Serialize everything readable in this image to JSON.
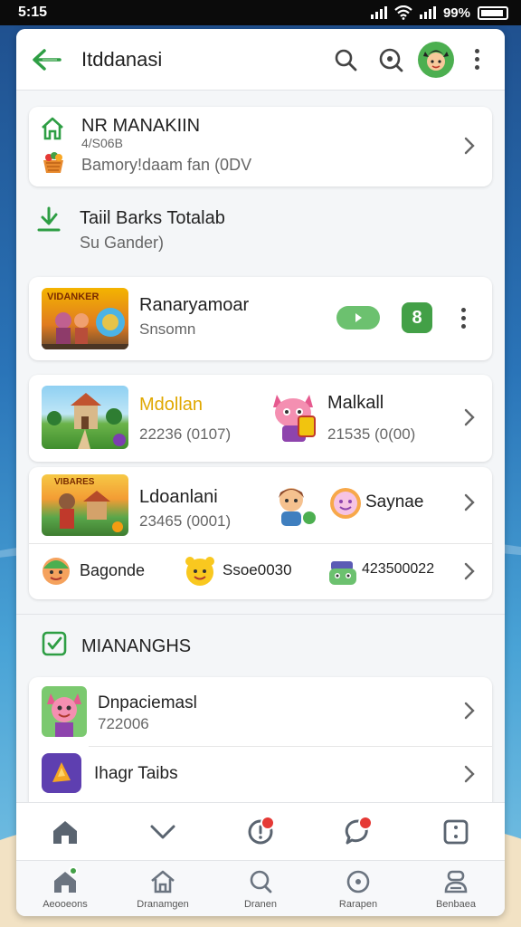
{
  "status": {
    "time": "5:15",
    "battery": "99%"
  },
  "appbar": {
    "title": "Itddanasi"
  },
  "section1": {
    "title": "NR MANAKIIN",
    "code": "4/S06B",
    "sub": "Bamory!daam fan (0DV"
  },
  "section2": {
    "title": "Taiil Barks Totalab",
    "sub": "Su Gander)"
  },
  "featured": {
    "thumb_text": "VIDANKER",
    "title": "Ranaryamoar",
    "sub": "Snsomn",
    "badge": "8"
  },
  "grid1": {
    "left": {
      "title": "Mdollan",
      "value": "22236 (0107)"
    },
    "right": {
      "title": "Malkall",
      "value": "21535 (0(00)"
    }
  },
  "grid2": {
    "left": {
      "thumb_text": "VIBARES",
      "title": "Ldoanlani",
      "value": "23465 (0001)"
    },
    "right": {
      "title": "Saynae"
    }
  },
  "friends": [
    {
      "name": "Bagonde"
    },
    {
      "name": "Ssoe0030"
    },
    {
      "name": "423500022"
    }
  ],
  "section3": {
    "title": "MIANANGHS"
  },
  "list": [
    {
      "title": "Dnpaciemasl",
      "value": "722006"
    },
    {
      "title": "Ihagr Taibs"
    }
  ],
  "nav": [
    {
      "label": "Aeooeons"
    },
    {
      "label": "Dranamgen"
    },
    {
      "label": "Dranen"
    },
    {
      "label": "Rarapen"
    },
    {
      "label": "Benbaea"
    }
  ],
  "colors": {
    "accent": "#43a047",
    "badge": "#e53935",
    "gold": "#e0a800"
  }
}
